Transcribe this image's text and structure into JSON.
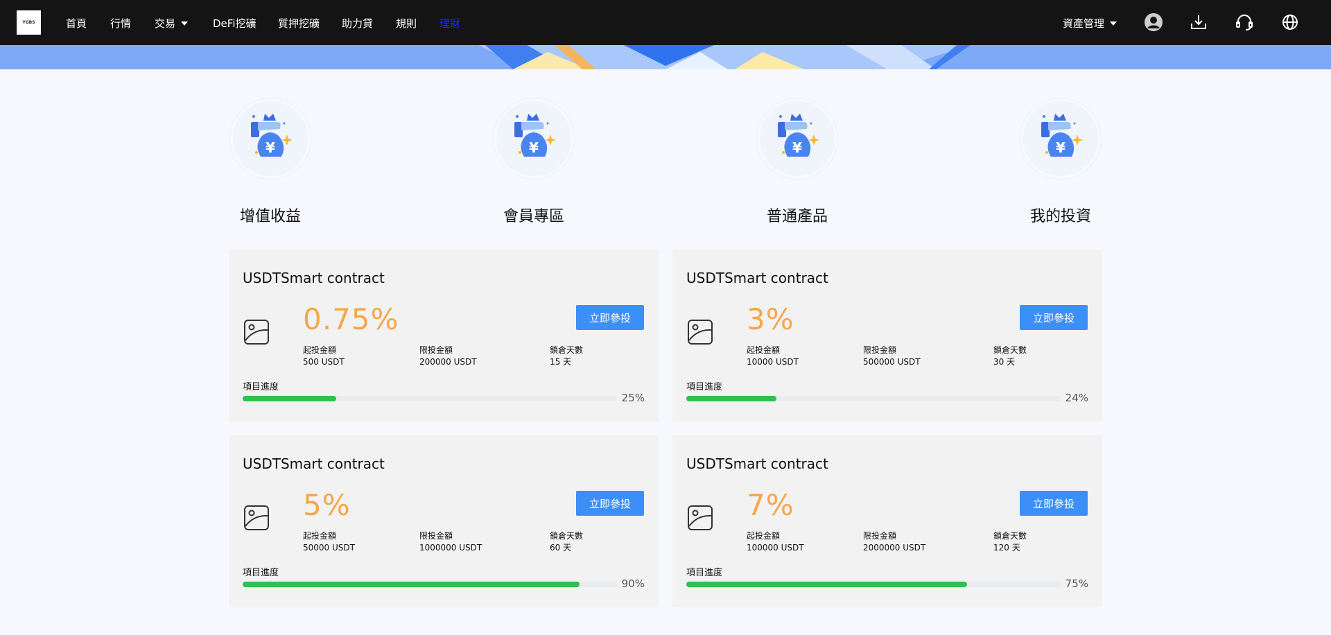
{
  "nav": {
    "logo_text": "YGBS",
    "items": [
      "首頁",
      "行情",
      "交易",
      "DeFi挖礦",
      "質押挖礦",
      "助力貸",
      "規則",
      "理財"
    ],
    "active_index": 7,
    "asset_menu": "資產管理",
    "icons": [
      "user-icon",
      "download-icon",
      "headset-icon",
      "globe-icon"
    ]
  },
  "categories": [
    {
      "label": "增值收益",
      "icon": "money-bag-icon"
    },
    {
      "label": "會員專區",
      "icon": "money-bag-icon"
    },
    {
      "label": "普通產品",
      "icon": "money-bag-icon"
    },
    {
      "label": "我的投資",
      "icon": "money-bag-icon"
    }
  ],
  "labels": {
    "min_invest": "起投金額",
    "max_invest": "限投金額",
    "lock_days": "鎖倉天數",
    "progress": "項目進度",
    "invest_button": "立即參投"
  },
  "products": [
    {
      "title": "USDTSmart contract",
      "rate": "0.75%",
      "min": "500 USDT",
      "max": "200000 USDT",
      "days": "15 天",
      "progress": 25,
      "progress_text": "25%"
    },
    {
      "title": "USDTSmart contract",
      "rate": "3%",
      "min": "10000 USDT",
      "max": "500000 USDT",
      "days": "30 天",
      "progress": 24,
      "progress_text": "24%"
    },
    {
      "title": "USDTSmart contract",
      "rate": "5%",
      "min": "50000 USDT",
      "max": "1000000 USDT",
      "days": "60 天",
      "progress": 90,
      "progress_text": "90%"
    },
    {
      "title": "USDTSmart contract",
      "rate": "7%",
      "min": "100000 USDT",
      "max": "2000000 USDT",
      "days": "120 天",
      "progress": 75,
      "progress_text": "75%"
    }
  ],
  "colors": {
    "nav_bg": "#141414",
    "active_nav": "#1f2bff",
    "rate": "#f7a64a",
    "button": "#3c8ff7",
    "progress": "#2fc04f",
    "banner": "#7ea9f6"
  }
}
